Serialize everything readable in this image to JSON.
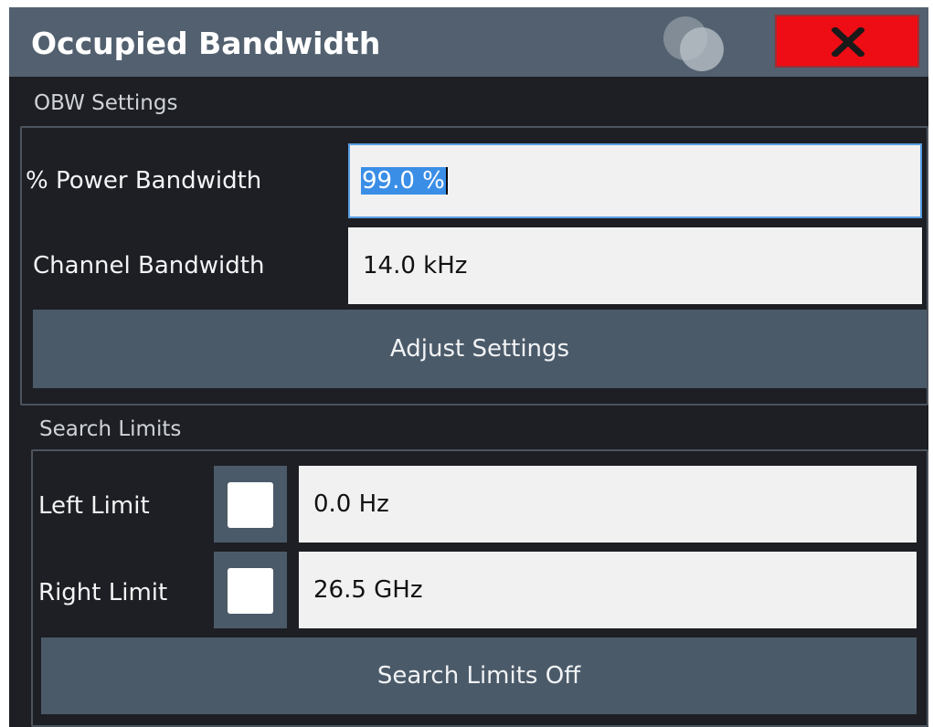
{
  "dialog": {
    "title": "Occupied Bandwidth",
    "close_label": "X"
  },
  "obw_settings": {
    "section_label": "OBW Settings",
    "power_bandwidth": {
      "label": "% Power Bandwidth",
      "value": "99.0 %"
    },
    "channel_bandwidth": {
      "label": "Channel Bandwidth",
      "value": "14.0 kHz"
    },
    "adjust_button": "Adjust Settings"
  },
  "search_limits": {
    "section_label": "Search Limits",
    "left_limit": {
      "label": "Left Limit",
      "value": "0.0 Hz",
      "checked": false
    },
    "right_limit": {
      "label": "Right Limit",
      "value": "26.5 GHz",
      "checked": false
    },
    "off_button": "Search Limits Off"
  },
  "colors": {
    "title_bar": "#52606f",
    "panel_bg": "#1d1f24",
    "close_red": "#ee0d14",
    "button_bg": "#4b5a69",
    "focus_blue": "#5a9fe2",
    "selection_blue": "#3a8ee6"
  },
  "icons": [
    "logo-circles-icon",
    "close-x-icon"
  ]
}
